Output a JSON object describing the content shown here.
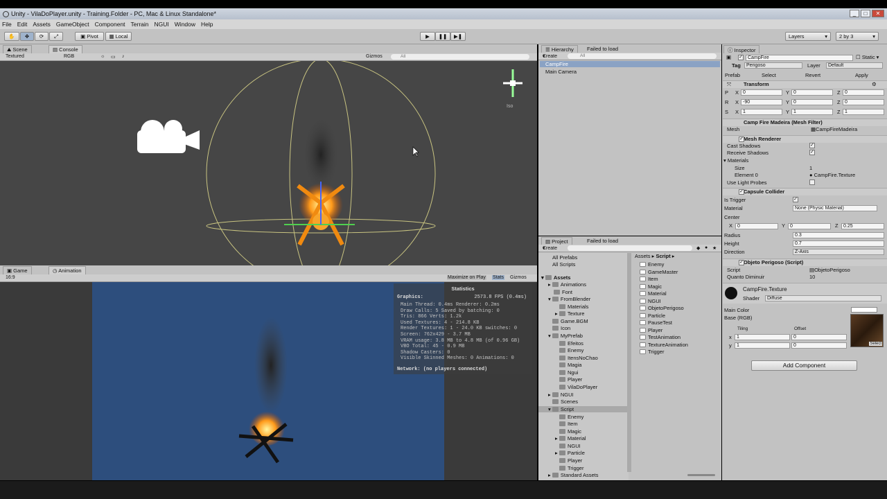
{
  "title": "Unity - VilaDoPlayer.unity - Training.Folder - PC, Mac & Linux Standalone*",
  "menu": [
    "File",
    "Edit",
    "Assets",
    "GameObject",
    "Component",
    "Terrain",
    "NGUI",
    "Window",
    "Help"
  ],
  "toolbar": {
    "pivot": "Pivot",
    "local": "Local",
    "layers": "Layers",
    "layout": "2 by 3"
  },
  "scene": {
    "tab": "Scene",
    "console_tab": "Console",
    "mode": "Textured",
    "rgb": "RGB",
    "gizmos": "Gizmos",
    "search": "All",
    "persp": "Iso"
  },
  "game": {
    "tab": "Game",
    "anim_tab": "Animation",
    "aspect": "16:9",
    "max": "Maximize on Play",
    "stats_btn": "Stats",
    "gizmos": "Gizmos",
    "stats": {
      "title": "Statistics",
      "graphics": "Graphics:",
      "fps": "2573.8 FPS (0.4ms)",
      "lines": [
        "Main Thread: 0.4ms   Renderer: 0.2ms",
        "Draw Calls: 5   Saved by batching: 0",
        "Tris: 866   Verts: 1.2k",
        "Used Textures: 4 - 214.8 KB",
        "Render Textures: 1 - 24.0 KB   switches: 0",
        "Screen: 762x429 - 3.7 MB",
        "VRAM usage: 3.8 MB to 4.8 MB (of 0.96 GB)",
        "VBO Total: 45 - 0.9 MB",
        "Shadow Casters: 0",
        "Visible Skinned Meshes: 0      Animations: 0"
      ],
      "network": "Network: (no players connected)"
    }
  },
  "hierarchy": {
    "tab": "Hierarchy",
    "failed": "Failed to load",
    "create": "Create",
    "search": "All",
    "items": [
      "CampFire",
      "Main Camera"
    ]
  },
  "project": {
    "tab": "Project",
    "failed": "Failed to load",
    "create": "Create",
    "favorites": [
      "All Prefabs",
      "All Scripts"
    ],
    "assets_label": "Assets",
    "tree": [
      "Animations",
      "Font",
      "FromBlender",
      "Materials",
      "Texture",
      "Game.BGM",
      "Icon",
      "MyPrefab",
      "Efeitos",
      "Enemy",
      "ItensNoChao",
      "Magia",
      "Ngui",
      "Player",
      "VilaDoPlayer",
      "NGUI",
      "Scenes",
      "Script",
      "Enemy",
      "Item",
      "Magic",
      "Material",
      "NGUI",
      "Particle",
      "Player",
      "Trigger",
      "Standard Assets"
    ],
    "breadcrumb": [
      "Assets",
      "Script"
    ],
    "files": [
      "Enemy",
      "GameMaster",
      "Item",
      "Magic",
      "Material",
      "NGUI",
      "ObjetoPerigoso",
      "Particle",
      "PauseTest",
      "Player",
      "TestAnimation",
      "TextureAnimation",
      "Trigger"
    ]
  },
  "inspector": {
    "tab": "Inspector",
    "name": "CampFire",
    "static": "Static",
    "tag_label": "Tag",
    "tag": "Perigoso",
    "layer_label": "Layer",
    "layer": "Default",
    "prefab_label": "Prefab",
    "select": "Select",
    "revert": "Revert",
    "apply": "Apply",
    "transform": "Transform",
    "pos": [
      "0",
      "0",
      "0"
    ],
    "rot": [
      "-90",
      "0",
      "0"
    ],
    "scale": [
      "1",
      "1",
      "1"
    ],
    "meshfilter": "Camp Fire Madeira (Mesh Filter)",
    "mesh_label": "Mesh",
    "mesh": "CampFireMadeira",
    "meshrenderer": "Mesh Renderer",
    "cast": "Cast Shadows",
    "receive": "Receive Shadows",
    "materials": "Materials",
    "size_label": "Size",
    "size": "1",
    "element_label": "Element 0",
    "element": "CampFire.Texture",
    "probes": "Use Light Probes",
    "collider": "Capsule Collider",
    "trigger": "Is Trigger",
    "material_label": "Material",
    "material": "None (Physic Material)",
    "center": "Center",
    "center_v": [
      "0",
      "0",
      "0.25"
    ],
    "radius_label": "Radius",
    "radius": "0.3",
    "height_label": "Height",
    "height": "0.7",
    "direction_label": "Direction",
    "direction": "Z-Axis",
    "script_comp": "Objeto Perigoso (Script)",
    "script_label": "Script",
    "script": "ObjetoPerigoso",
    "dano_label": "Quanto Diminuir",
    "dano": "10",
    "mat_name": "CampFire.Texture",
    "shader_label": "Shader",
    "shader": "Diffuse",
    "main_color": "Main Color",
    "base": "Base (RGB)",
    "tiling": "Tiling",
    "offset": "Offset",
    "tiling_v": [
      "1",
      "1"
    ],
    "offset_v": [
      "0",
      "0"
    ],
    "select_tex": "Select",
    "add": "Add Component"
  }
}
